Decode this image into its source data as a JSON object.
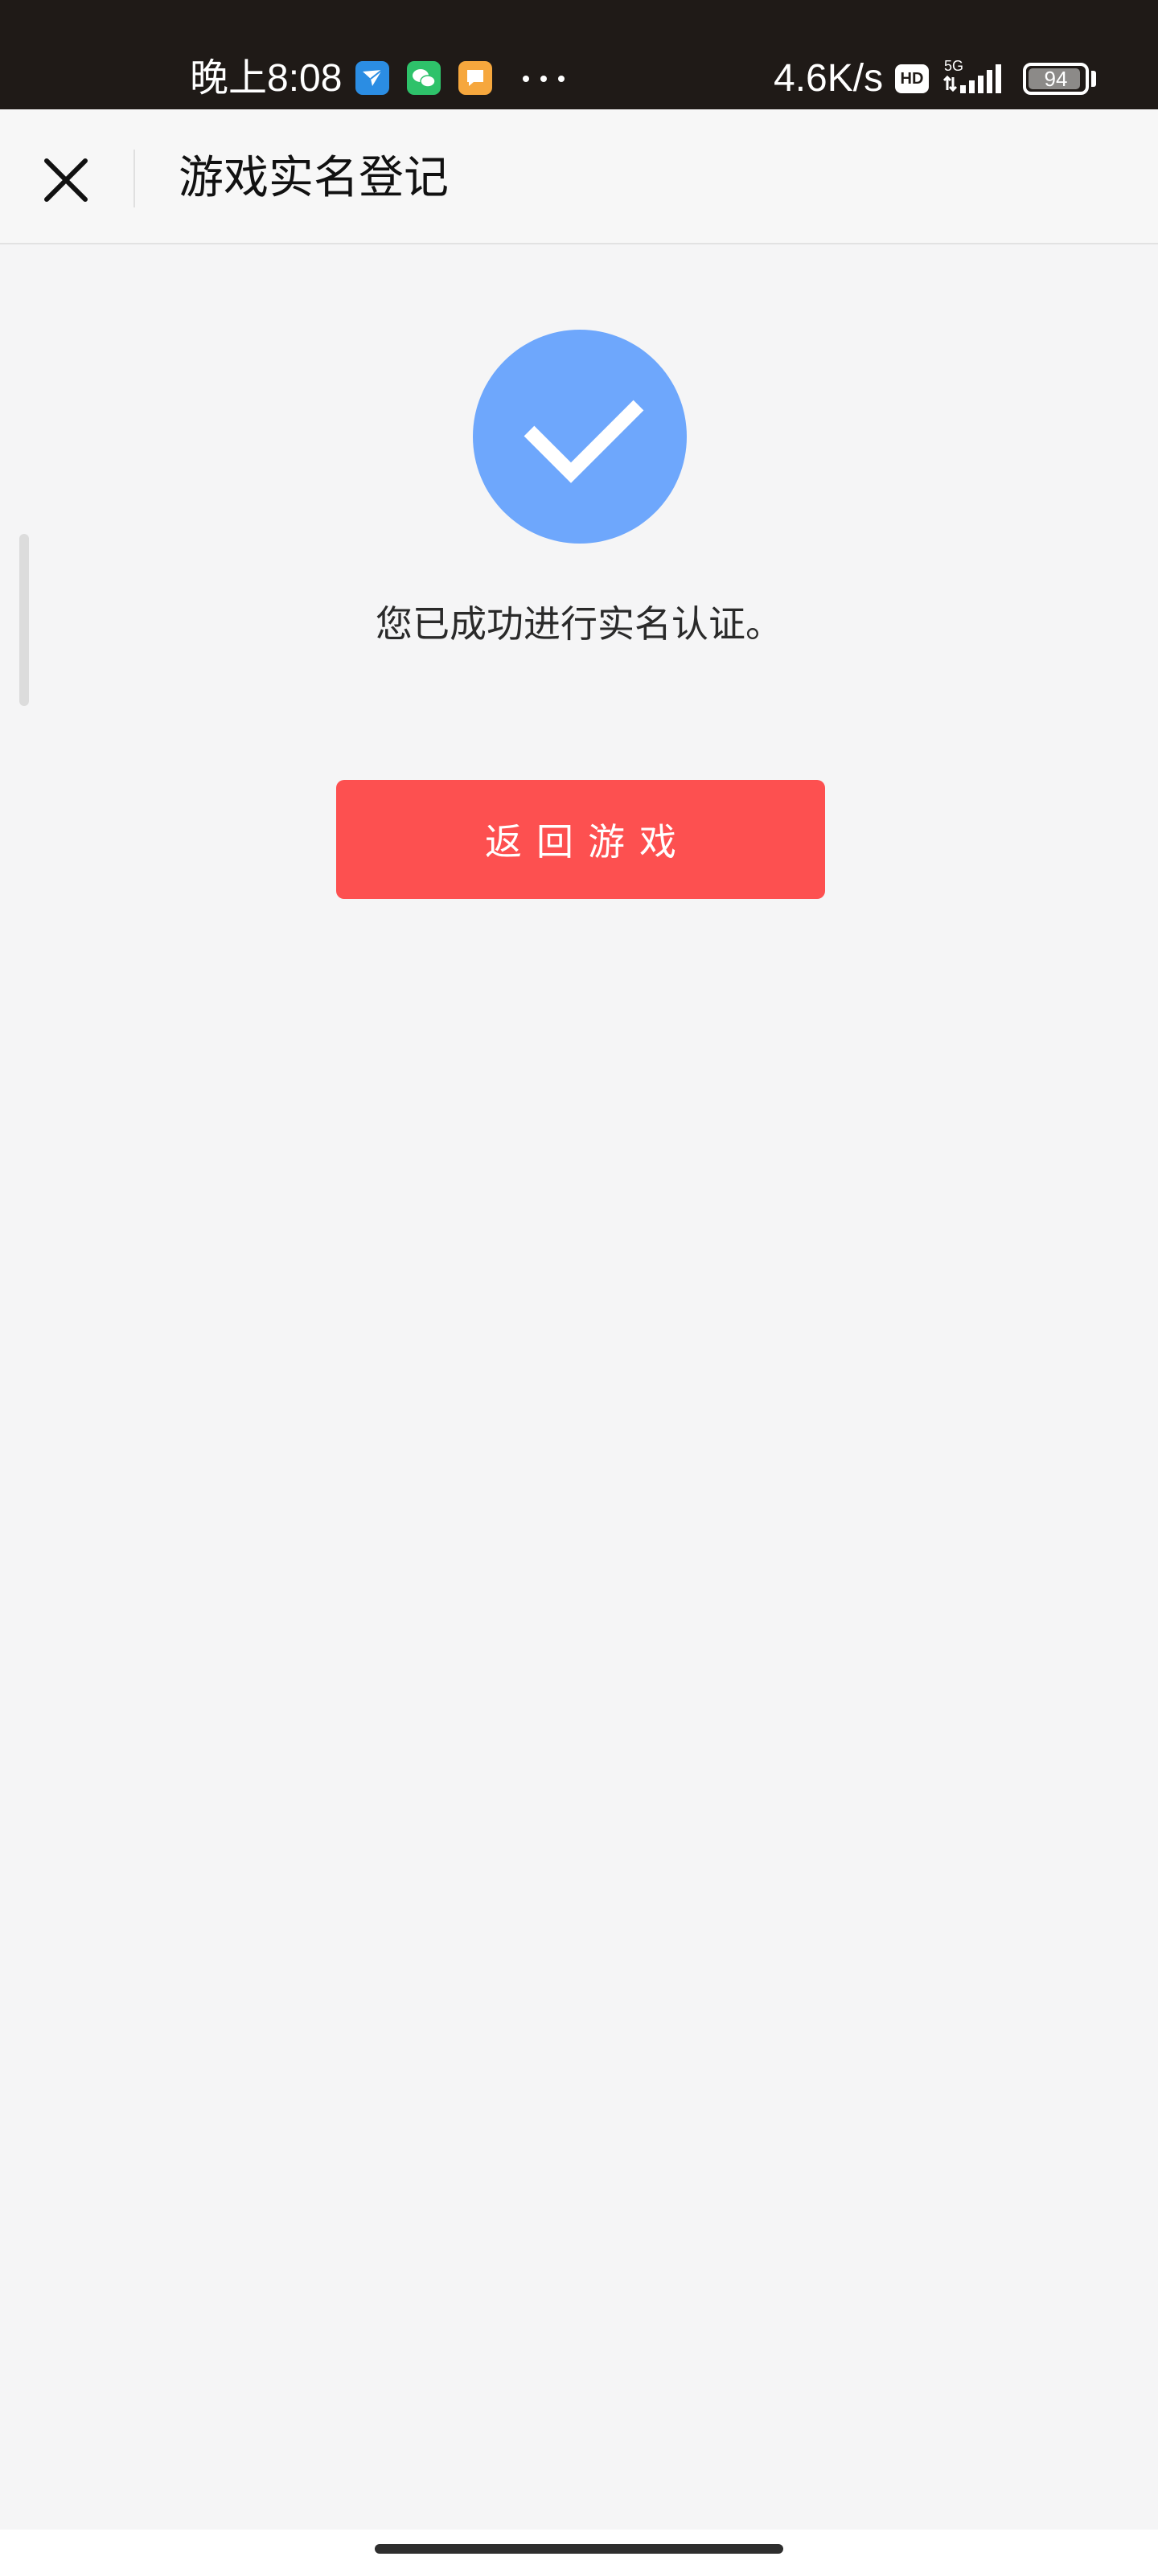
{
  "status_bar": {
    "time": "晚上8:08",
    "app_icons": [
      "airmail-icon",
      "wechat-icon",
      "message-icon"
    ],
    "network_speed": "4.6K/s",
    "hd_badge": "HD",
    "network_type": "5G",
    "battery_level": "94",
    "battery_fraction": 0.94
  },
  "header": {
    "title": "游戏实名登记"
  },
  "main": {
    "success_message": "您已成功进行实名认证。",
    "return_button_label": "返回游戏"
  },
  "colors": {
    "success_circle": "#6ea7fc",
    "button_red": "#fd5050",
    "status_bar_bg": "#1f1a17",
    "page_bg": "#f5f5f6"
  }
}
